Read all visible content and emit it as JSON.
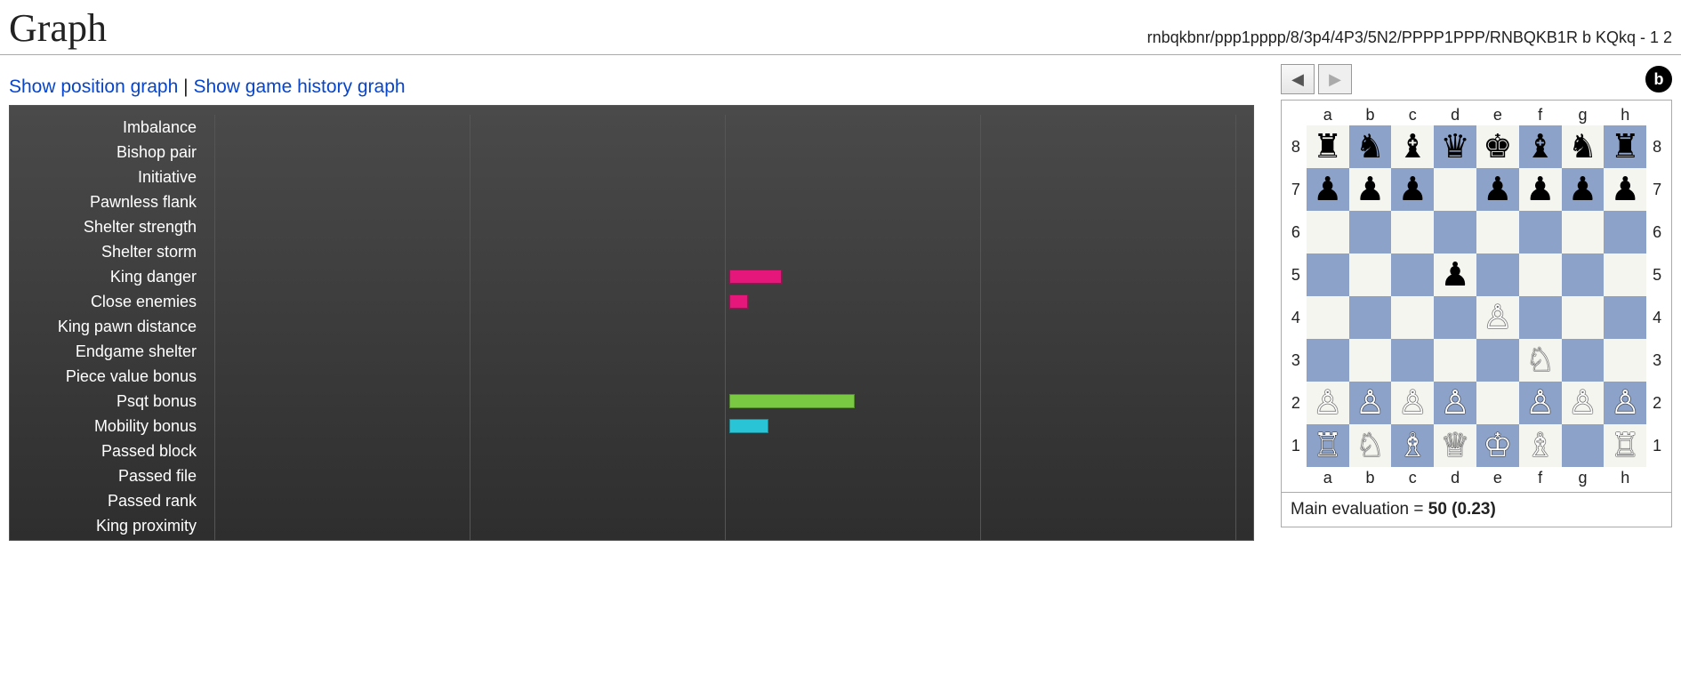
{
  "header": {
    "title": "Graph",
    "fen": "rnbqkbnr/ppp1pppp/8/3p4/4P3/5N2/PPPP1PPP/RNBQKB1R b KQkq - 1 2"
  },
  "graph_links": {
    "position": "Show position graph",
    "history": "Show game history graph"
  },
  "chart_data": {
    "type": "bar",
    "orientation": "horizontal",
    "xlim": [
      -200,
      200
    ],
    "grid_x": [
      -200,
      -100,
      0,
      100,
      200
    ],
    "zero_at_percent": 50,
    "categories": [
      "Imbalance",
      "Bishop pair",
      "Initiative",
      "Pawnless flank",
      "Shelter strength",
      "Shelter storm",
      "King danger",
      "Close enemies",
      "King pawn distance",
      "Endgame shelter",
      "Piece value bonus",
      "Psqt bonus",
      "Mobility bonus",
      "Passed block",
      "Passed file",
      "Passed rank",
      "King proximity"
    ],
    "values": [
      0,
      0,
      0,
      0,
      0,
      0,
      20,
      7,
      0,
      0,
      0,
      48,
      15,
      0,
      0,
      0,
      0
    ],
    "colors": [
      "",
      "",
      "",
      "",
      "",
      "",
      "#e6177a",
      "#e6177a",
      "",
      "",
      "",
      "#7ac943",
      "#29c5d6",
      "",
      "",
      "",
      ""
    ]
  },
  "nav": {
    "prev_icon": "◀",
    "next_icon": "▶",
    "turn_badge": "b"
  },
  "board": {
    "files": [
      "a",
      "b",
      "c",
      "d",
      "e",
      "f",
      "g",
      "h"
    ],
    "ranks": [
      "8",
      "7",
      "6",
      "5",
      "4",
      "3",
      "2",
      "1"
    ],
    "position_fen": "rnbqkbnr/ppp1pppp/8/3p4/4P3/5N2/PPPP1PPP/RNBQKB1R",
    "piece_glyphs": {
      "K": "♔",
      "Q": "♕",
      "R": "♖",
      "B": "♗",
      "N": "♘",
      "P": "♙",
      "k": "♚",
      "q": "♛",
      "r": "♜",
      "b": "♝",
      "n": "♞",
      "p": "♟"
    }
  },
  "evaluation": {
    "label_prefix": "Main evaluation = ",
    "value": "50 (0.23)"
  }
}
